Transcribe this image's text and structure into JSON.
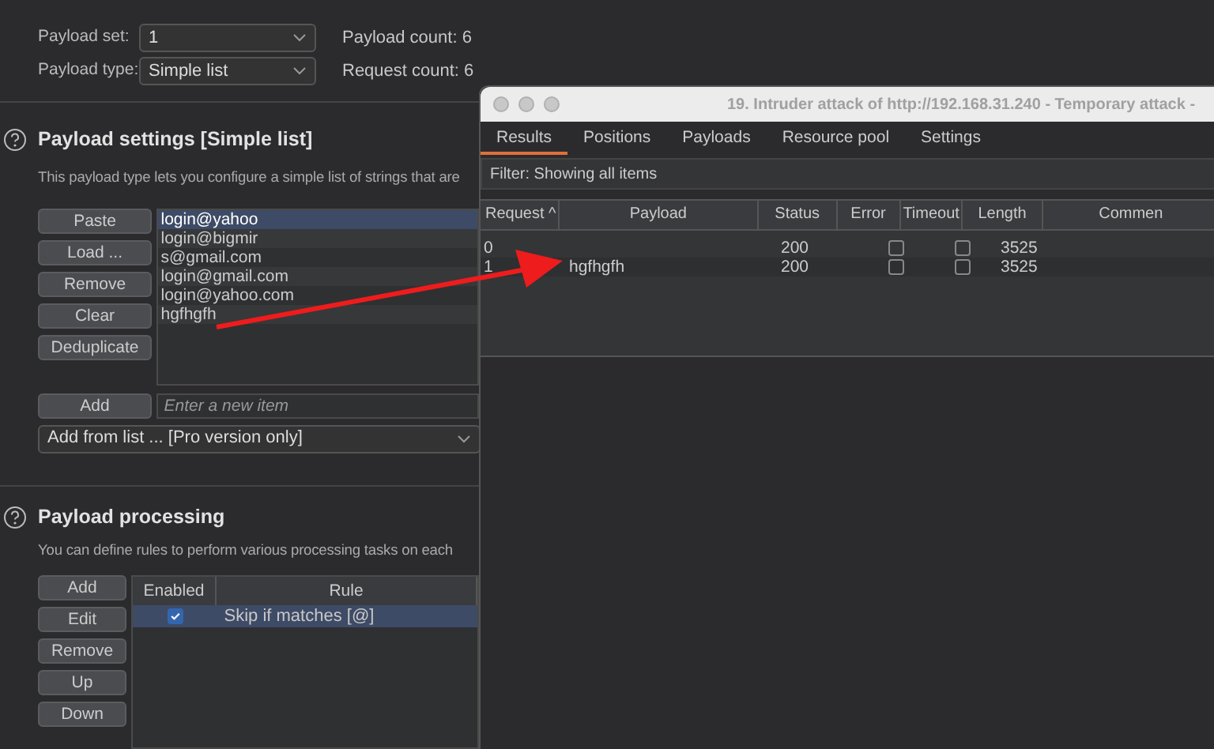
{
  "payload_set": {
    "label": "Payload set:",
    "value": "1"
  },
  "payload_type": {
    "label": "Payload type:",
    "value": "Simple list"
  },
  "counts": [
    {
      "label": "Payload count:",
      "value": "6"
    },
    {
      "label": "Request count:",
      "value": "6"
    }
  ],
  "payload_settings": {
    "title": "Payload settings [Simple list]",
    "description": "This payload type lets you configure a simple list of strings that are",
    "buttons": [
      "Paste",
      "Load ...",
      "Remove",
      "Clear",
      "Deduplicate"
    ],
    "items": [
      {
        "text": "login@yahoo",
        "selected": true
      },
      {
        "text": "login@bigmir",
        "selected": false
      },
      {
        "text": "s@gmail.com",
        "selected": false
      },
      {
        "text": "login@gmail.com",
        "selected": false
      },
      {
        "text": "login@yahoo.com",
        "selected": false
      },
      {
        "text": "hgfhgfh",
        "selected": false
      }
    ],
    "add_button": "Add",
    "new_item": {
      "placeholder": "Enter a new item"
    },
    "add_from_list": "Add from list ... [Pro version only]"
  },
  "payload_processing": {
    "title": "Payload processing",
    "description": "You can define rules to perform various processing tasks on each",
    "buttons": [
      "Add",
      "Edit",
      "Remove",
      "Up",
      "Down"
    ],
    "columns": [
      "Enabled",
      "Rule"
    ],
    "rules": [
      {
        "enabled": true,
        "rule": "Skip if matches [@]",
        "selected": true
      }
    ]
  },
  "attack_window": {
    "title": "19. Intruder attack of http://192.168.31.240 - Temporary attack -",
    "tabs": [
      {
        "label": "Results",
        "selected": true
      },
      {
        "label": "Positions",
        "selected": false
      },
      {
        "label": "Payloads",
        "selected": false
      },
      {
        "label": "Resource pool",
        "selected": false
      },
      {
        "label": "Settings",
        "selected": false
      }
    ],
    "filter": "Filter: Showing all items",
    "columns": [
      "Request ^",
      "Payload",
      "Status",
      "Error",
      "Timeout",
      "Length",
      "Commen"
    ],
    "rows": [
      {
        "request": "0",
        "payload": "",
        "status": "200",
        "error": false,
        "timeout": false,
        "length": "3525"
      },
      {
        "request": "1",
        "payload": "hgfhgfh",
        "status": "200",
        "error": false,
        "timeout": false,
        "length": "3525"
      }
    ]
  }
}
